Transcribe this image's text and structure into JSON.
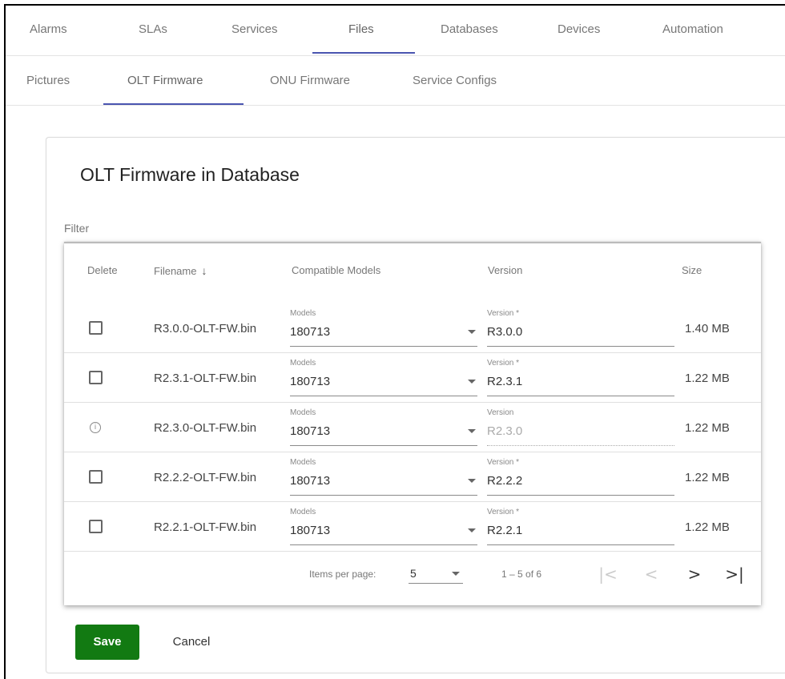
{
  "top_tabs": [
    "Alarms",
    "SLAs",
    "Services",
    "Files",
    "Databases",
    "Devices",
    "Automation"
  ],
  "top_active": "Files",
  "sub_tabs": [
    "Pictures",
    "OLT Firmware",
    "ONU Firmware",
    "Service Configs"
  ],
  "sub_active": "OLT Firmware",
  "card": {
    "title": "OLT Firmware in Database",
    "filter_label": "Filter"
  },
  "table": {
    "headers": {
      "delete": "Delete",
      "filename": "Filename",
      "models": "Compatible Models",
      "version": "Version",
      "size": "Size"
    },
    "sort_icon": "arrow-down-icon",
    "rows": [
      {
        "delete_type": "checkbox",
        "filename": "R3.0.0-OLT-FW.bin",
        "models_label": "Models",
        "models_value": "180713",
        "version_label": "Version *",
        "version_value": "R3.0.0",
        "version_disabled": false,
        "size": "1.40 MB"
      },
      {
        "delete_type": "checkbox",
        "filename": "R2.3.1-OLT-FW.bin",
        "models_label": "Models",
        "models_value": "180713",
        "version_label": "Version *",
        "version_value": "R2.3.1",
        "version_disabled": false,
        "size": "1.22 MB"
      },
      {
        "delete_type": "info",
        "filename": "R2.3.0-OLT-FW.bin",
        "models_label": "Models",
        "models_value": "180713",
        "version_label": "Version",
        "version_value": "R2.3.0",
        "version_disabled": true,
        "size": "1.22 MB"
      },
      {
        "delete_type": "checkbox",
        "filename": "R2.2.2-OLT-FW.bin",
        "models_label": "Models",
        "models_value": "180713",
        "version_label": "Version *",
        "version_value": "R2.2.2",
        "version_disabled": false,
        "size": "1.22 MB"
      },
      {
        "delete_type": "checkbox",
        "filename": "R2.2.1-OLT-FW.bin",
        "models_label": "Models",
        "models_value": "180713",
        "version_label": "Version *",
        "version_value": "R2.2.1",
        "version_disabled": false,
        "size": "1.22 MB"
      }
    ]
  },
  "paginator": {
    "items_per_page_label": "Items per page:",
    "items_per_page_value": "5",
    "range_label": "1 – 5 of 6",
    "first_icon": "first-page-icon",
    "prev_icon": "previous-page-icon",
    "next_icon": "next-page-icon",
    "last_icon": "last-page-icon"
  },
  "actions": {
    "save_label": "Save",
    "cancel_label": "Cancel"
  },
  "colors": {
    "accent": "#4a55b0",
    "save_button": "#127a12"
  }
}
